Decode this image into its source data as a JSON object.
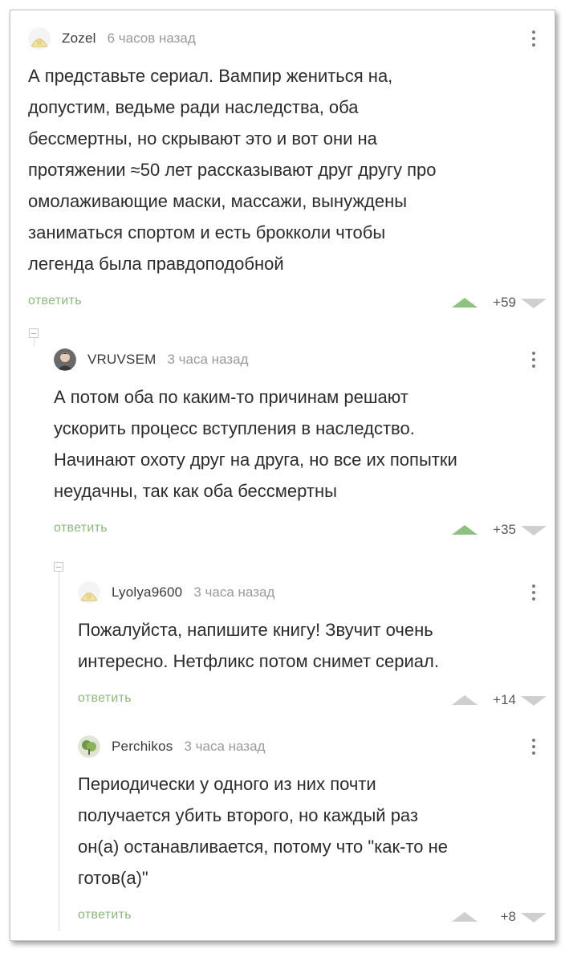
{
  "comments": [
    {
      "username": "Zozel",
      "time": "6 часов назад",
      "lines": [
        "А представьте сериал. Вампир жениться на,",
        "допустим, ведьме ради наследства, оба",
        "бессмертны, но скрывают это и вот они на",
        "протяжении ≈50 лет рассказывают друг другу про",
        "омолаживающие маски, массажи, вынуждены",
        "заниматься спортом и есть брокколи чтобы",
        "легенда была правдоподобной"
      ],
      "reply_label": "ответить",
      "rating": "+59",
      "upvoted": true
    },
    {
      "username": "VRUVSEM",
      "time": "3 часа назад",
      "lines": [
        "А потом оба по каким-то причинам решают",
        "ускорить процесс вступления в наследство.",
        "Начинают охоту друг на друга, но все их попытки",
        "неудачны, так как оба бессмертны"
      ],
      "reply_label": "ответить",
      "rating": "+35",
      "upvoted": true
    },
    {
      "username": "Lyolya9600",
      "time": "3 часа назад",
      "lines": [
        "Пожалуйста, напишите книгу! Звучит очень",
        "интересно. Нетфликс потом снимет сериал."
      ],
      "reply_label": "ответить",
      "rating": "+14",
      "upvoted": false
    },
    {
      "username": "Perchikos",
      "time": "3 часа назад",
      "lines": [
        "Периодически у одного из них почти",
        "получается убить второго, но каждый раз",
        "он(а) останавливается, потому что \"как-то не",
        "готов(а)\""
      ],
      "reply_label": "ответить",
      "rating": "+8",
      "upvoted": false
    }
  ],
  "colors": {
    "reply": "#8bb97e",
    "upvote_active": "#8ec180",
    "vote_inactive": "#cfcfcf"
  },
  "icons": {
    "menu": "more-vertical-icon",
    "upvote": "triangle-up-icon",
    "downvote": "triangle-down-icon",
    "collapse": "collapse-minus-icon"
  }
}
